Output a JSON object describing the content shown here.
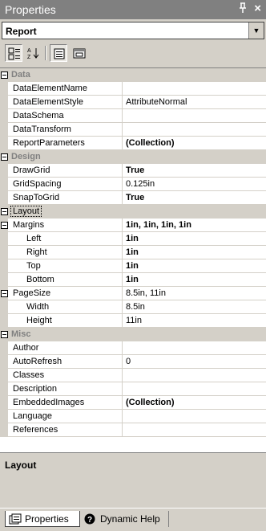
{
  "window": {
    "title": "Properties",
    "pin_glyph": "p",
    "close_glyph": "×"
  },
  "object_selector": {
    "value": "Report",
    "dropdown_icon": "chevron-down-icon"
  },
  "toolbar": {
    "buttons": [
      {
        "name": "categorized",
        "icon": "categorized-icon",
        "pressed": true
      },
      {
        "name": "alphabetical",
        "icon": "alphabetical-sort-icon",
        "pressed": false
      },
      {
        "name": "properties",
        "icon": "properties-page-icon",
        "pressed": true
      },
      {
        "name": "property-pages",
        "icon": "property-pages-icon",
        "pressed": false
      }
    ]
  },
  "grid": {
    "rows": [
      {
        "kind": "category",
        "label": "Data"
      },
      {
        "kind": "prop",
        "label": "DataElementName",
        "value": ""
      },
      {
        "kind": "prop",
        "label": "DataElementStyle",
        "value": "AttributeNormal"
      },
      {
        "kind": "prop",
        "label": "DataSchema",
        "value": ""
      },
      {
        "kind": "prop",
        "label": "DataTransform",
        "value": ""
      },
      {
        "kind": "prop",
        "label": "ReportParameters",
        "value": "(Collection)",
        "bold": true
      },
      {
        "kind": "category",
        "label": "Design"
      },
      {
        "kind": "prop",
        "label": "DrawGrid",
        "value": "True",
        "bold": true
      },
      {
        "kind": "prop",
        "label": "GridSpacing",
        "value": "0.125in"
      },
      {
        "kind": "prop",
        "label": "SnapToGrid",
        "value": "True",
        "bold": true
      },
      {
        "kind": "category",
        "label": "Layout",
        "selected": true
      },
      {
        "kind": "prop",
        "label": "Margins",
        "value": "1in, 1in, 1in, 1in",
        "bold": true,
        "expandable": true
      },
      {
        "kind": "sub",
        "label": "Left",
        "value": "1in",
        "bold": true
      },
      {
        "kind": "sub",
        "label": "Right",
        "value": "1in",
        "bold": true
      },
      {
        "kind": "sub",
        "label": "Top",
        "value": "1in",
        "bold": true
      },
      {
        "kind": "sub",
        "label": "Bottom",
        "value": "1in",
        "bold": true
      },
      {
        "kind": "prop",
        "label": "PageSize",
        "value": "8.5in, 11in",
        "expandable": true
      },
      {
        "kind": "sub",
        "label": "Width",
        "value": "8.5in"
      },
      {
        "kind": "sub",
        "label": "Height",
        "value": "11in"
      },
      {
        "kind": "category",
        "label": "Misc"
      },
      {
        "kind": "prop",
        "label": "Author",
        "value": ""
      },
      {
        "kind": "prop",
        "label": "AutoRefresh",
        "value": "0"
      },
      {
        "kind": "prop",
        "label": "Classes",
        "value": ""
      },
      {
        "kind": "prop",
        "label": "Description",
        "value": ""
      },
      {
        "kind": "prop",
        "label": "EmbeddedImages",
        "value": "(Collection)",
        "bold": true
      },
      {
        "kind": "prop",
        "label": "Language",
        "value": ""
      },
      {
        "kind": "prop",
        "label": "References",
        "value": ""
      }
    ]
  },
  "description": {
    "title": "Layout"
  },
  "tabs": [
    {
      "label": "Properties",
      "icon": "properties-tab-icon",
      "active": true
    },
    {
      "label": "Dynamic Help",
      "icon": "help-icon",
      "active": false
    }
  ]
}
